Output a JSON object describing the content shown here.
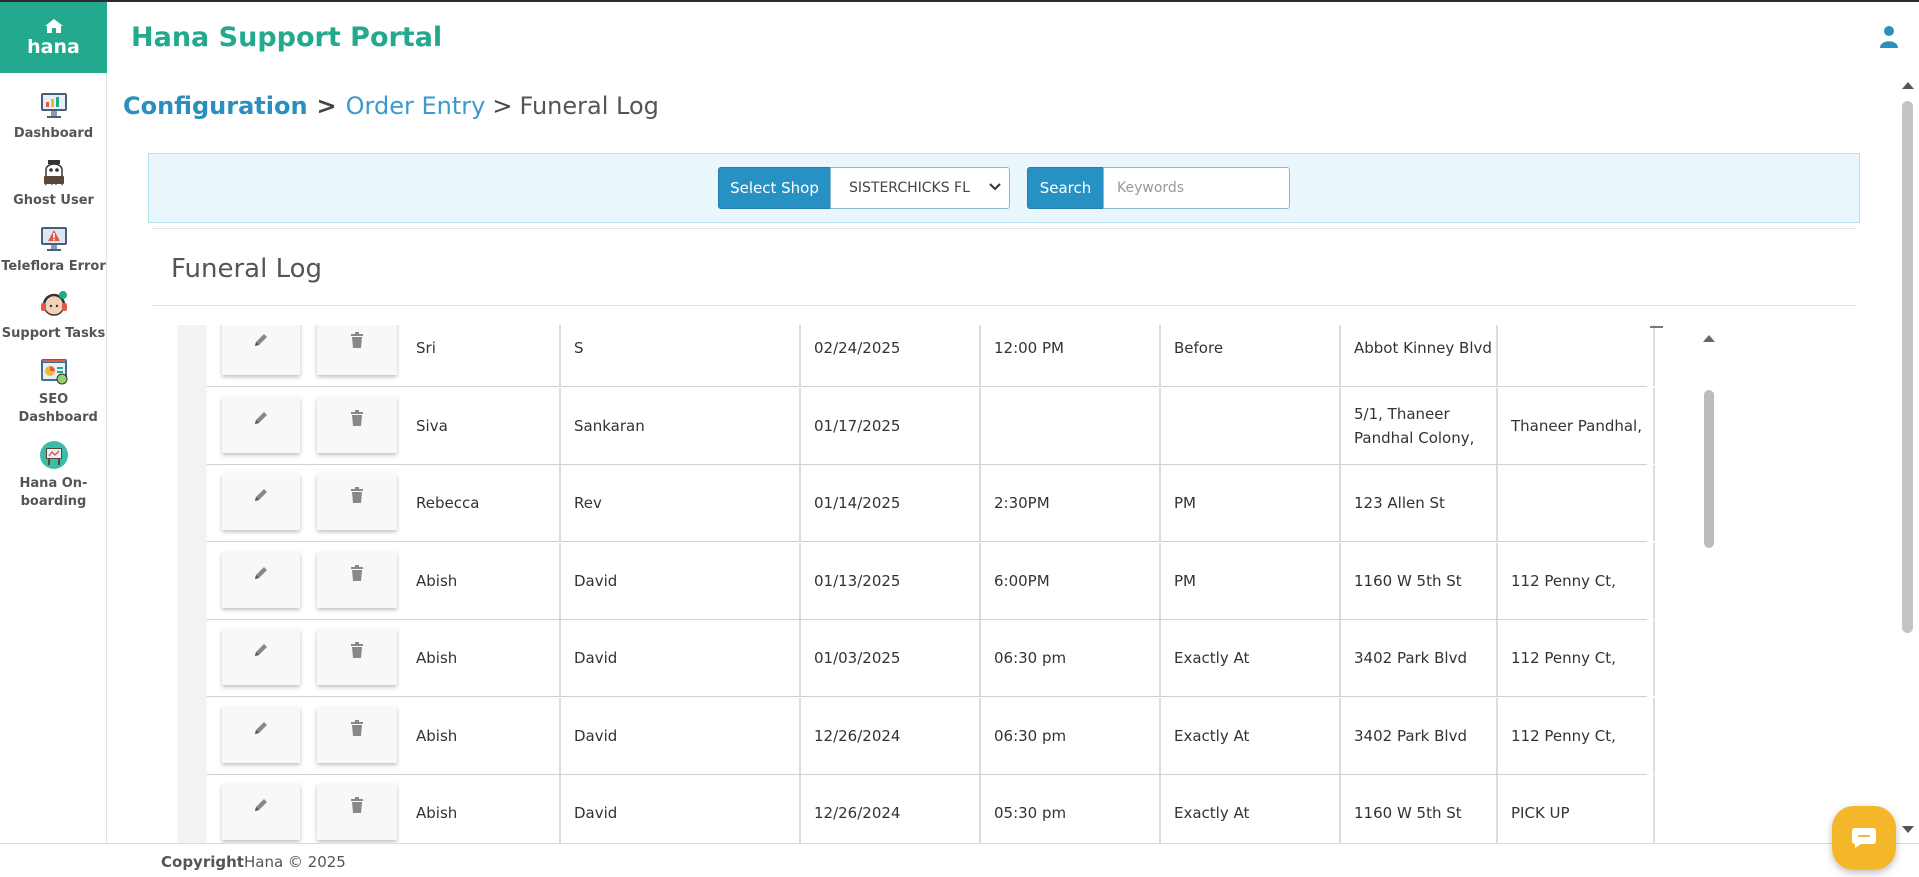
{
  "app": {
    "brand": "hana",
    "title": "Hana Support Portal"
  },
  "sidebar": {
    "items": [
      {
        "label": "Dashboard",
        "icon": "dashboard-icon"
      },
      {
        "label": "Ghost User",
        "icon": "ghost-user-icon"
      },
      {
        "label": "Teleflora Error",
        "icon": "teleflora-error-icon"
      },
      {
        "label": "Support Tasks",
        "icon": "support-tasks-icon"
      },
      {
        "label": "SEO Dashboard",
        "icon": "seo-dashboard-icon"
      },
      {
        "label": "Hana On-boarding",
        "icon": "hana-onboarding-icon"
      }
    ]
  },
  "breadcrumb": {
    "root": "Configuration",
    "sep1": ">",
    "link": "Order Entry",
    "sep2": ">",
    "current": "Funeral Log"
  },
  "filters": {
    "select_shop_label": "Select Shop",
    "shop_value": "SISTERCHICKS FL",
    "search_label": "Search",
    "search_placeholder": "Keywords",
    "search_value": ""
  },
  "section_title": "Funeral Log",
  "table": {
    "rows": [
      {
        "first": "Sri",
        "last": "S",
        "date": "02/24/2025",
        "time": "12:00 PM",
        "when": "Before",
        "addr1": "Abbot Kinney Blvd",
        "addr2": ""
      },
      {
        "first": "Siva",
        "last": "Sankaran",
        "date": "01/17/2025",
        "time": "",
        "when": "",
        "addr1": "5/1, Thaneer Pandhal Colony,",
        "addr2": "Thaneer Pandhal,"
      },
      {
        "first": "Rebecca",
        "last": "Rev",
        "date": "01/14/2025",
        "time": "2:30PM",
        "when": "PM",
        "addr1": "123 Allen St",
        "addr2": ""
      },
      {
        "first": "Abish",
        "last": "David",
        "date": "01/13/2025",
        "time": "6:00PM",
        "when": "PM",
        "addr1": "1160 W 5th St",
        "addr2": "112 Penny Ct,"
      },
      {
        "first": "Abish",
        "last": "David",
        "date": "01/03/2025",
        "time": "06:30 pm",
        "when": "Exactly At",
        "addr1": "3402 Park Blvd",
        "addr2": "112 Penny Ct,"
      },
      {
        "first": "Abish",
        "last": "David",
        "date": "12/26/2024",
        "time": "06:30 pm",
        "when": "Exactly At",
        "addr1": "3402 Park Blvd",
        "addr2": "112 Penny Ct,"
      },
      {
        "first": "Abish",
        "last": "David",
        "date": "12/26/2024",
        "time": "05:30 pm",
        "when": "Exactly At",
        "addr1": "1160 W 5th St",
        "addr2": "PICK UP"
      }
    ]
  },
  "footer": {
    "copyright_label": "Copyright",
    "copyright_text": "Hana © 2025"
  },
  "colors": {
    "brand_green": "#22a98e",
    "primary_blue": "#2891c4",
    "link_blue": "#3a9ad0",
    "filter_bg": "#e9f6fb",
    "chat_yellow": "#f5b72a"
  }
}
